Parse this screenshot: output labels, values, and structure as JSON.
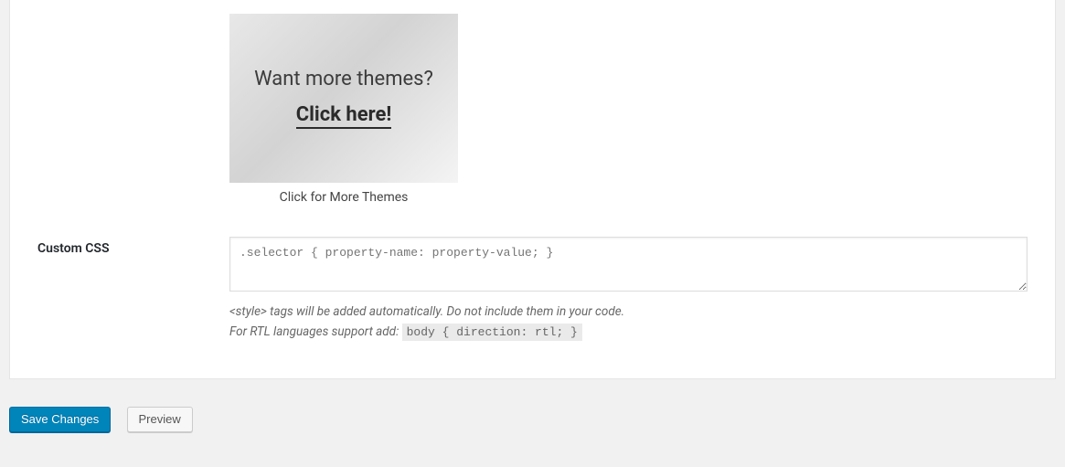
{
  "promo": {
    "title": "Want more themes?",
    "cta": "Click here!",
    "caption": "Click for More Themes"
  },
  "css": {
    "label": "Custom CSS",
    "placeholder": ".selector { property-name: property-value; }",
    "note_line1": "<style> tags will be added automatically. Do not include them in your code.",
    "note_line2_prefix": "For RTL languages support add: ",
    "note_line2_code": "body { direction: rtl; }"
  },
  "buttons": {
    "save": "Save Changes",
    "preview": "Preview"
  }
}
